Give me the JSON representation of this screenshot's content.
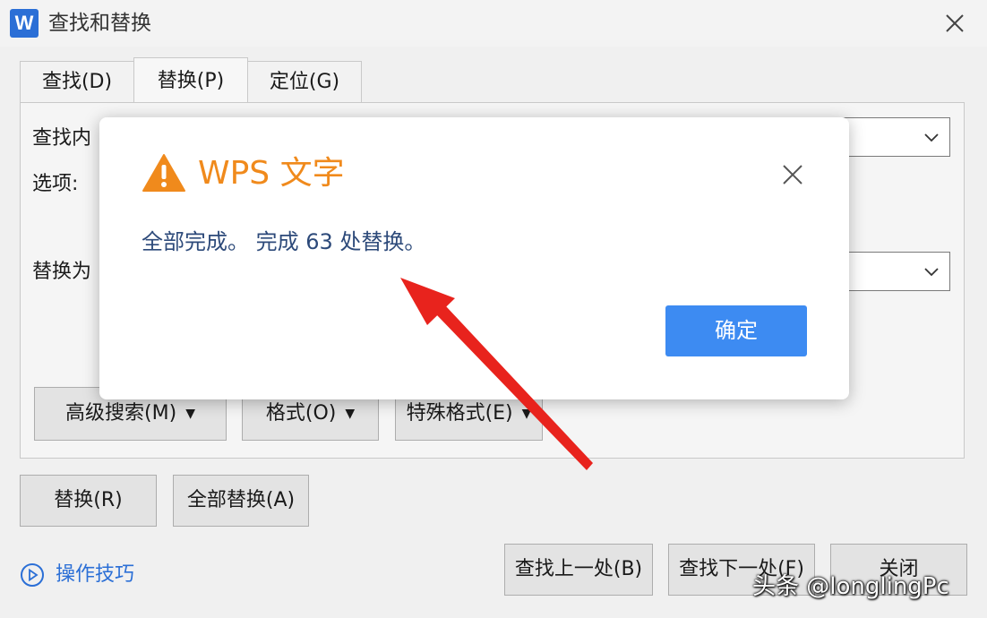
{
  "window": {
    "logo": "W",
    "title": "查找和替换",
    "close_icon": "close-icon"
  },
  "tabs": [
    {
      "label": "查找(D)",
      "active": false
    },
    {
      "label": "替换(P)",
      "active": true
    },
    {
      "label": "定位(G)",
      "active": false
    }
  ],
  "panel": {
    "find_label": "查找内容",
    "find_label_visible": "查找内",
    "options_label": "选项:",
    "replace_label": "替换为",
    "replace_label_visible": "替换为",
    "advanced_button": "高级搜索(M)",
    "format_button": "格式(O)",
    "special_button": "特殊格式(E)"
  },
  "actions": {
    "replace": "替换(R)",
    "replace_all": "全部替换(A)",
    "find_prev": "查找上一处(B)",
    "find_next": "查找下一处(F)",
    "close": "关闭"
  },
  "help": {
    "label": "操作技巧"
  },
  "dialog": {
    "title": "WPS 文字",
    "message": "全部完成。 完成 63 处替换。",
    "ok": "确定",
    "icon": "warning-icon",
    "accent": "#f08a1c",
    "button_color": "#3d8bf2"
  },
  "watermark": "头条 @longlingPc",
  "colors": {
    "brand": "#2b6fd6",
    "arrow": "#e8231d"
  }
}
